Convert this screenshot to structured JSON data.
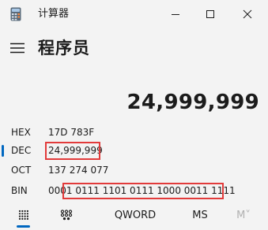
{
  "window": {
    "title": "计算器",
    "minimize_icon": "minimize-icon",
    "maximize_icon": "maximize-icon",
    "close_icon": "close-icon"
  },
  "header": {
    "menu_icon": "hamburger-icon",
    "mode_title": "程序员"
  },
  "display": {
    "value": "24,999,999"
  },
  "radix": [
    {
      "label": "HEX",
      "value": "17D 783F",
      "active": false
    },
    {
      "label": "DEC",
      "value": "24,999,999",
      "active": true
    },
    {
      "label": "OCT",
      "value": "137 274 077",
      "active": false
    },
    {
      "label": "BIN",
      "value": "0001 0111 1101 0111 1000 0011 1111",
      "active": false
    }
  ],
  "toolbar": {
    "keypad_icon": "full-keypad-icon",
    "bitflip_icon": "bit-toggle-keypad-icon",
    "word_size": "QWORD",
    "ms_label": "MS",
    "m_down_label": "M˅"
  },
  "colors": {
    "background": "#f3f3f3",
    "accent": "#0067c0",
    "highlight": "#e23b3b"
  }
}
